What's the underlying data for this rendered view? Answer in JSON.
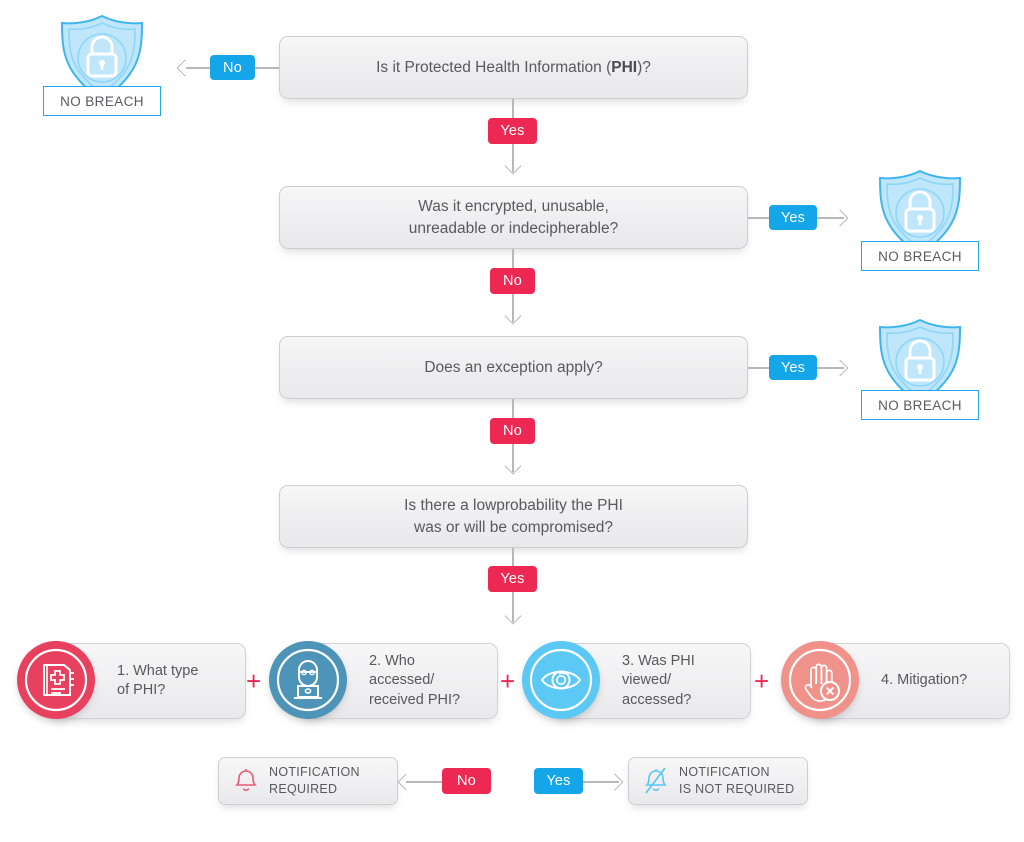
{
  "title": "HIPAA Breach Notification Decision Flowchart",
  "colors": {
    "yes_red": "#ec2853",
    "no_blue": "#14a6e8",
    "shield_blue": "#21a8ee",
    "shield_fill": "#bfe6fb",
    "box_text": "#59595e",
    "connector": "#b9b7bc",
    "card1": "#e8405f",
    "card2": "#4e93b8",
    "card3": "#5bc8f5",
    "card4": "#f0918a"
  },
  "decisions": [
    {
      "id": "phi",
      "text_before": "Is it Protected Health Information (",
      "text_bold": "PHI",
      "text_after": ")?",
      "branch_left_label": "No",
      "branch_down_label": "Yes"
    },
    {
      "id": "encrypted",
      "line1": "Was it encrypted, unusable,",
      "line2": "unreadable or indecipherable?",
      "branch_right_label": "Yes",
      "branch_down_label": "No"
    },
    {
      "id": "exception",
      "line1": "Does an exception apply?",
      "branch_right_label": "Yes",
      "branch_down_label": "No"
    },
    {
      "id": "lowprobability",
      "line1": "Is there a lowprobability the PHI",
      "line2": "was or will be compromised?",
      "branch_down_label": "Yes"
    }
  ],
  "outcomes": {
    "no_breach_label": "NO BREACH",
    "shield_icon": "shield-lock-icon"
  },
  "factors": [
    {
      "number_and_line1": "1. What type",
      "line2": "of PHI?",
      "line3": "",
      "icon": "medical-record-book-icon",
      "color": "#e8405f"
    },
    {
      "number_and_line1": "2. Who",
      "line2": "accessed/",
      "line3": "received PHI?",
      "icon": "hacker-laptop-icon",
      "color": "#4e93b8"
    },
    {
      "number_and_line1": "3. Was PHI",
      "line2": "viewed/",
      "line3": "accessed?",
      "icon": "eye-icon",
      "color": "#5bc8f5"
    },
    {
      "number_and_line1": "4. Mitigation?",
      "line2": "",
      "line3": "",
      "icon": "hand-stop-x-icon",
      "color": "#f0918a"
    }
  ],
  "plus_symbol": "+",
  "notification": {
    "required": {
      "line1": "NOTIFICATION",
      "line2": "REQUIRED",
      "icon": "bell-icon",
      "branch_label": "No"
    },
    "not_required": {
      "line1": "NOTIFICATION",
      "line2": "IS NOT REQUIRED",
      "icon": "bell-off-icon",
      "branch_label": "Yes"
    }
  }
}
